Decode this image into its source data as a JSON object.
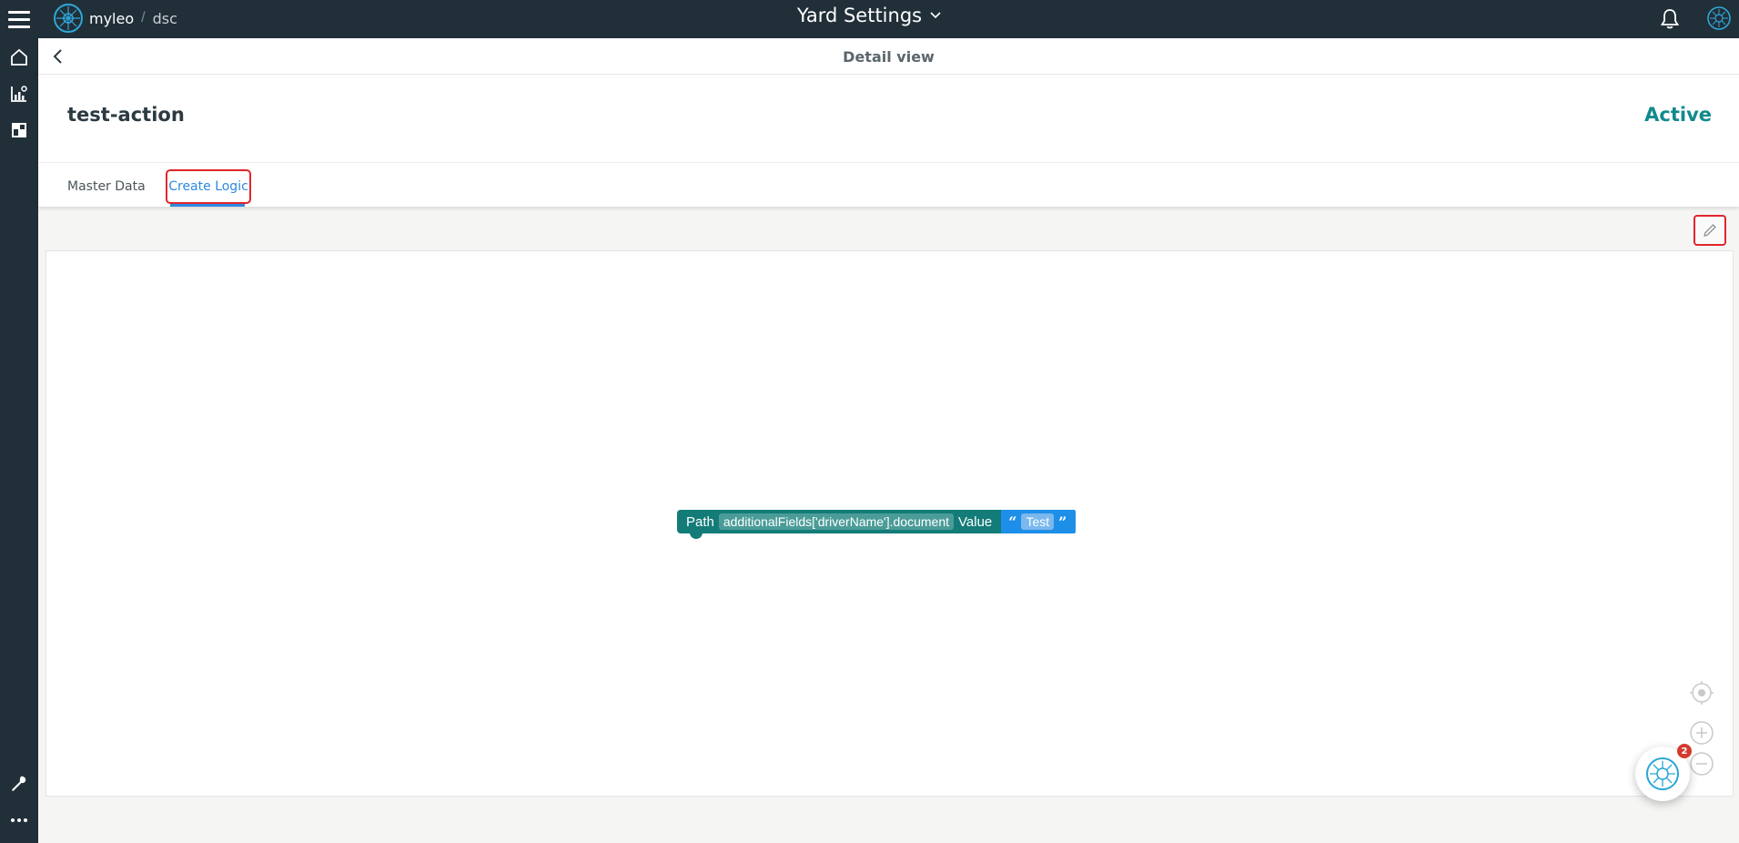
{
  "brand": {
    "name": "myleo",
    "separator": "/",
    "product": "dsc"
  },
  "header": {
    "app_title": "Yard Settings"
  },
  "detail": {
    "subheader_title": "Detail view",
    "entity_name": "test-action",
    "status": "Active",
    "status_color": "#108a8c"
  },
  "tabs": [
    {
      "label": "Master Data",
      "active": false
    },
    {
      "label": "Create Logic",
      "active": true
    }
  ],
  "block": {
    "path_keyword": "Path",
    "path_value": "additionalFields['driverName'].document",
    "value_keyword": "Value",
    "open_quote": "“",
    "text_value": "Test",
    "close_quote": "”",
    "color_main": "#137c78",
    "color_text": "#1e8fe8"
  },
  "assistant": {
    "badge_count": "2"
  },
  "icons": {
    "menu": "hamburger-icon",
    "home": "home-icon",
    "analytics": "chart-icon",
    "dashboard": "dashboard-icon",
    "tools": "wrench-icon",
    "more": "more-icon",
    "notifications": "bell-icon",
    "back": "chevron-left-icon",
    "edit": "pencil-icon",
    "recenter": "target-icon",
    "zoom_in": "plus-icon",
    "zoom_out": "minus-icon"
  }
}
